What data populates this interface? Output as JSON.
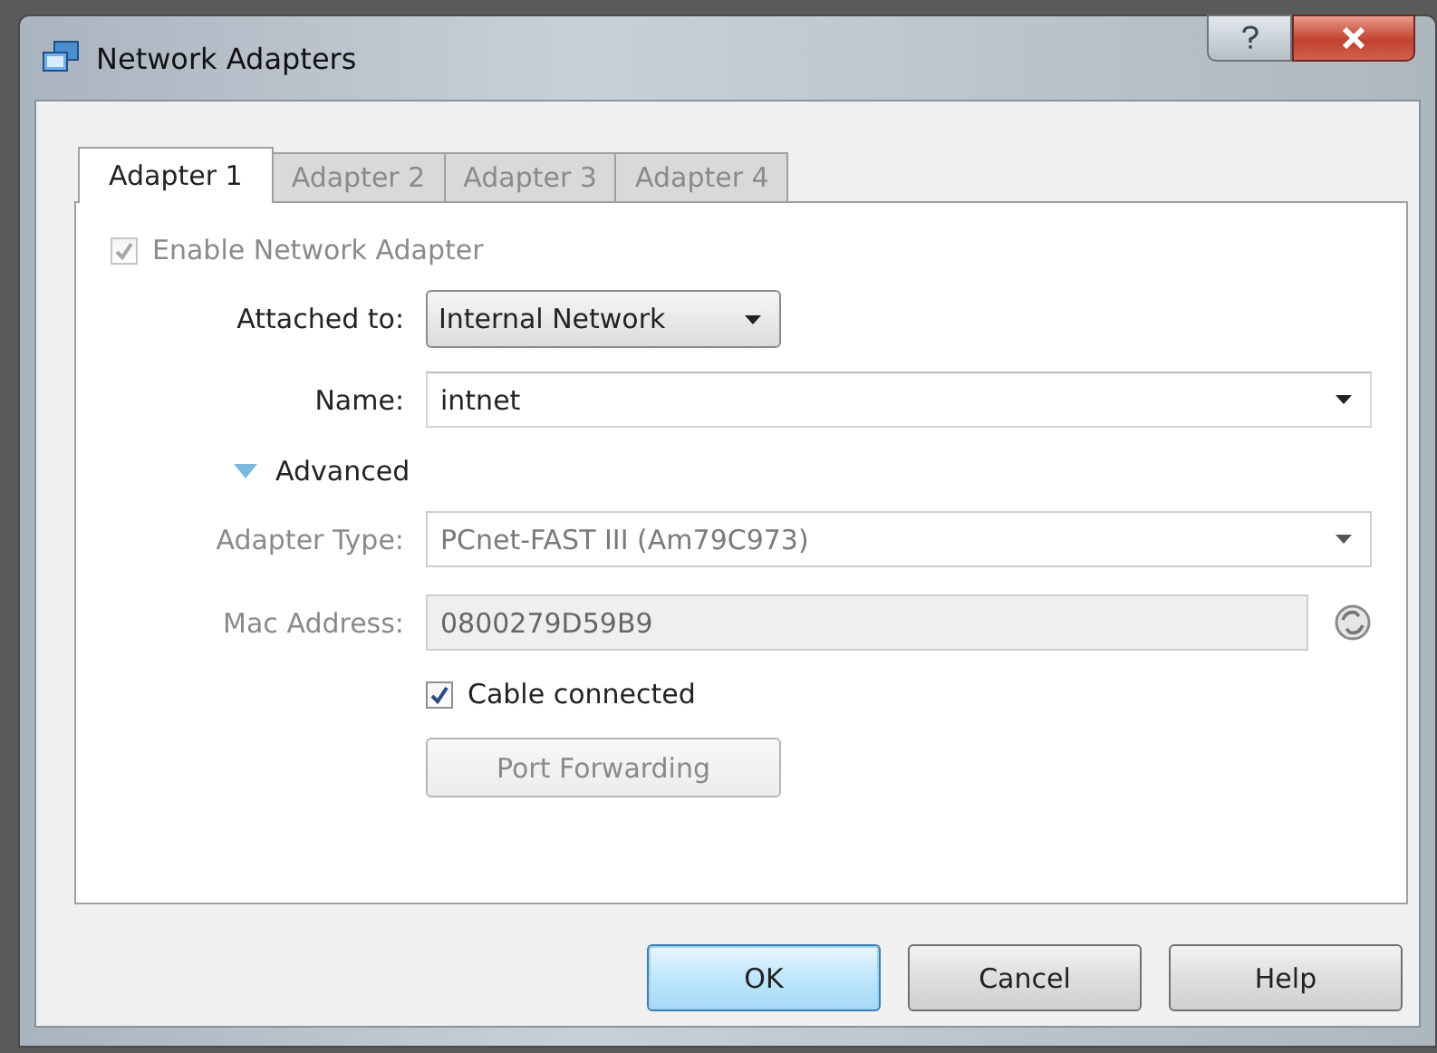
{
  "window": {
    "title": "Network Adapters"
  },
  "tabs": [
    {
      "label": "Adapter 1",
      "selected": true
    },
    {
      "label": "Adapter 2",
      "selected": false
    },
    {
      "label": "Adapter 3",
      "selected": false
    },
    {
      "label": "Adapter 4",
      "selected": false
    }
  ],
  "enable_adapter": {
    "label": "Enable Network Adapter",
    "checked": true,
    "disabled": true
  },
  "attached_to": {
    "label": "Attached to:",
    "value": "Internal Network"
  },
  "name": {
    "label": "Name:",
    "value": "intnet"
  },
  "advanced": {
    "label": "Advanced",
    "expanded": true
  },
  "adapter_type": {
    "label": "Adapter Type:",
    "value": "PCnet-FAST III (Am79C973)",
    "disabled": true
  },
  "mac_address": {
    "label": "Mac Address:",
    "value": "0800279D59B9",
    "disabled": true
  },
  "cable_connected": {
    "label": "Cable connected",
    "checked": true,
    "disabled": false
  },
  "port_forwarding": {
    "label": "Port Forwarding",
    "disabled": true
  },
  "buttons": [
    {
      "label": "OK",
      "default": true
    },
    {
      "label": "Cancel",
      "default": false
    },
    {
      "label": "Help",
      "default": false
    }
  ]
}
